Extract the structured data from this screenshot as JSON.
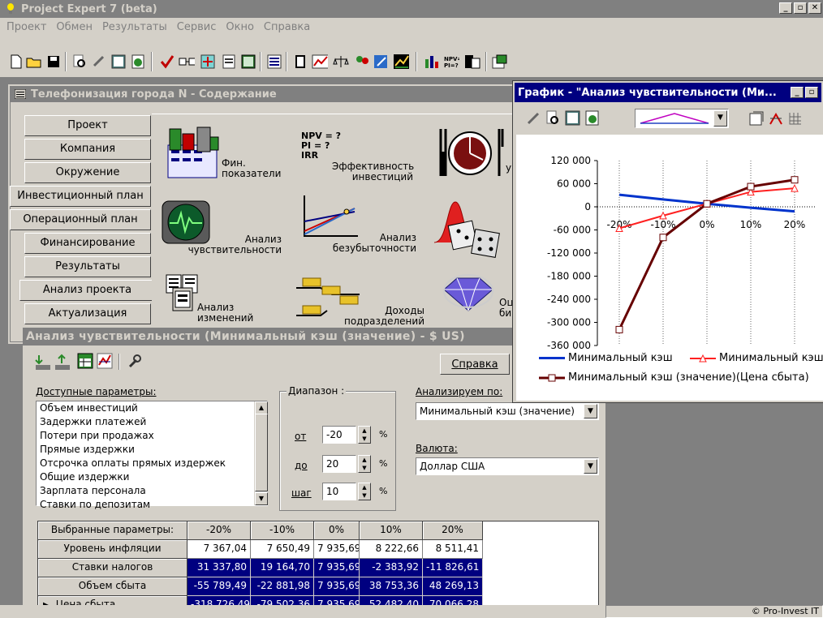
{
  "app": {
    "title": "Project Expert 7 (beta)",
    "win_buttons": [
      "_",
      "▫",
      "✕"
    ]
  },
  "menu": [
    "Проект",
    "Обмен",
    "Результаты",
    "Сервис",
    "Окно",
    "Справка"
  ],
  "contents_window": {
    "title": "Телефонизация города N - Содержание",
    "tabs": [
      "Проект",
      "Компания",
      "Окружение",
      "Инвестиционный план",
      "Операционный план",
      "Финансирование",
      "Результаты",
      "Анализ проекта",
      "Актуализация"
    ],
    "items": {
      "fin": [
        "Фин.",
        "показатели"
      ],
      "eff": [
        "Эффективность",
        "инвестиций"
      ],
      "sens": [
        "Анализ",
        "чувствительности"
      ],
      "be": [
        "Анализ",
        "безубыточности"
      ],
      "changes": [
        "Анализ",
        "изменений"
      ],
      "income": [
        "Доходы",
        "подразделений"
      ],
      "partial_right": [
        "уча"
      ],
      "partial_right2": [
        "Оц",
        "би"
      ]
    },
    "eff_icon_text": [
      "NPV = ?",
      "PI = ?",
      "IRR"
    ]
  },
  "graph_window": {
    "title": "График - \"Анализ чувствительности (Ми...",
    "legend": [
      {
        "label": "Минимальный кэш",
        "color": "#0033cc"
      },
      {
        "label": "Минимальный кэш",
        "color": "#ff2020"
      },
      {
        "label": "Минимальный кэш (значение)(Цена сбыта)",
        "color": "#660000"
      }
    ]
  },
  "chart_data": {
    "type": "line",
    "x": [
      "-20%",
      "-10%",
      "0%",
      "10%",
      "20%"
    ],
    "y_ticks": [
      "120 000",
      "60 000",
      "0",
      "-60 000",
      "-120 000",
      "-180 000",
      "-240 000",
      "-300 000",
      "-360 000"
    ],
    "ylim": [
      -360000,
      120000
    ],
    "grid": true,
    "series": [
      {
        "name": "Минимальный кэш",
        "color": "#0033cc",
        "marker": "none",
        "values": [
          31337.8,
          19164.7,
          7935.69,
          -2383.92,
          -11826.61
        ]
      },
      {
        "name": "Минимальный кэш",
        "color": "#ff2020",
        "marker": "triangle",
        "values": [
          -55789.49,
          -22881.98,
          7935.69,
          38753.36,
          48269.13
        ]
      },
      {
        "name": "Минимальный кэш (значение)(Цена сбыта)",
        "color": "#660000",
        "marker": "square",
        "values": [
          -318726.49,
          -79502.36,
          7935.69,
          52482.4,
          70066.28
        ]
      }
    ]
  },
  "sens_window": {
    "title": "Анализ чувствительности (Минимальный кэш (значение) - $ US)",
    "help_button": "Справка",
    "params_label": "Доступные параметры:",
    "params": [
      "Объем инвестиций",
      "Задержки платежей",
      "Потери при продажах",
      "Прямые издержки",
      "Отсрочка оплаты прямых издержек",
      "Общие издержки",
      "Зарплата персонала",
      "Ставки по депозитам"
    ],
    "range_label": "Диапазон :",
    "from_label": "от",
    "from_value": "-20",
    "to_label": "до",
    "to_value": "20",
    "step_label": "шаг",
    "step_value": "10",
    "percent": "%",
    "analyze_label": "Анализируем по:",
    "analyze_value": "Минимальный кэш (значение)",
    "currency_label": "Валюта:",
    "currency_value": "Доллар США"
  },
  "table": {
    "header": [
      "Выбранные параметры:",
      "-20%",
      "-10%",
      "0%",
      "10%",
      "20%"
    ],
    "rows": [
      {
        "name": "Уровень инфляции",
        "values": [
          "7 367,04",
          "7 650,49",
          "7 935,69",
          "8 222,66",
          "8 511,41"
        ],
        "selected": false,
        "current": false
      },
      {
        "name": "Ставки налогов",
        "values": [
          "31 337,80",
          "19 164,70",
          "7 935,69",
          "-2 383,92",
          "-11 826,61"
        ],
        "selected": true,
        "current": false
      },
      {
        "name": "Объем сбыта",
        "values": [
          "-55 789,49",
          "-22 881,98",
          "7 935,69",
          "38 753,36",
          "48 269,13"
        ],
        "selected": true,
        "current": false
      },
      {
        "name": "Цена сбыта",
        "values": [
          "-318 726,49",
          "-79 502,36",
          "7 935,69",
          "52 482,40",
          "70 066,28"
        ],
        "selected": true,
        "current": true
      }
    ]
  },
  "status": {
    "copyright": "© Pro-Invest IT"
  }
}
